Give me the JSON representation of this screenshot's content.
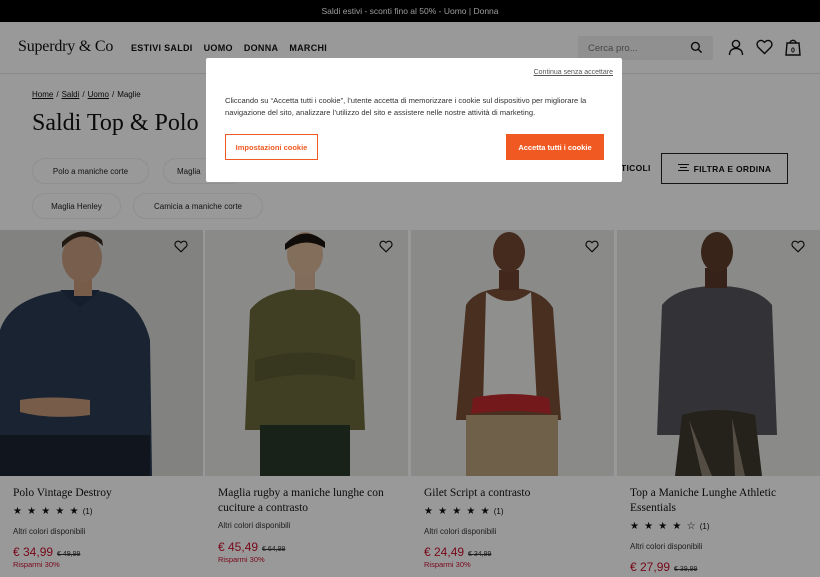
{
  "promo": {
    "text": "Saldi estivi - sconti fino al 50%  -  Uomo | Donna"
  },
  "header": {
    "logo": "Superdry & Co",
    "nav": [
      "ESTIVI SALDI",
      "UOMO",
      "DONNA",
      "MARCHI"
    ],
    "search_placeholder": "Cerca pro...",
    "bag_count": "0"
  },
  "breadcrumb": [
    "Home",
    "Saldi",
    "Uomo",
    "Maglie"
  ],
  "page_title": "Saldi Top & Polo",
  "chips": [
    "Polo a maniche corte",
    "Maglia",
    "Maglia Henley",
    "Camicia a maniche corte"
  ],
  "articles_label": "TICOLI",
  "filter_label": "FILTRA E ORDINA",
  "products": [
    {
      "name": "Polo Vintage Destroy",
      "stars": "★ ★ ★ ★ ★",
      "rating_count": "(1)",
      "colors": "Altri colori disponibili",
      "price": "€ 34,99",
      "old_price": "€ 49,99",
      "saving": "Risparmi 30%"
    },
    {
      "name": "Maglia rugby a maniche lunghe con cuciture a contrasto",
      "colors": "Altri colori disponibili",
      "price": "€ 45,49",
      "old_price": "€ 64,99",
      "saving": "Risparmi 30%"
    },
    {
      "name": "Gilet Script a contrasto",
      "stars": "★ ★ ★ ★ ★",
      "rating_count": "(1)",
      "colors": "Altri colori disponibili",
      "price": "€ 24,49",
      "old_price": "€ 34,99",
      "saving": "Risparmi 30%"
    },
    {
      "name": "Top a Maniche Lunghe Athletic Essentials",
      "stars": "★ ★ ★ ★ ☆",
      "rating_count": "(1)",
      "colors": "Altri colori disponibili",
      "price": "€ 27,99",
      "old_price": "€ 39,99"
    }
  ],
  "cookie": {
    "continue_label": "Continua senza accettare",
    "message": "Cliccando su “Accetta tutti i cookie”, l’utente accetta di memorizzare i cookie sul dispositivo per migliorare la navigazione del sito, analizzare l’utilizzo del sito e assistere nelle nostre attività di marketing.",
    "settings_label": "Impostazioni cookie",
    "accept_label": "Accetta tutti i cookie"
  },
  "colors": {
    "accent": "#f05a22",
    "sale": "#c8102e",
    "promo_bg": "#000000"
  }
}
